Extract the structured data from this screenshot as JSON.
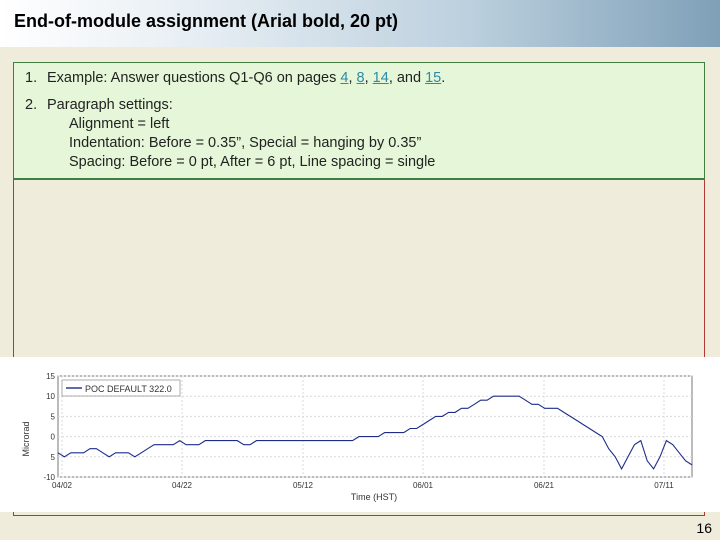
{
  "slide": {
    "title": "End-of-module assignment (Arial bold, 20 pt)",
    "page_number": "16"
  },
  "instructions": {
    "item1": {
      "number": "1.",
      "text_before": "Example: Answer questions Q1-Q6 on pages ",
      "pages": [
        "4",
        "8",
        "14",
        "15"
      ],
      "sep1": ", ",
      "sep2": ", ",
      "sep3": ", and ",
      "end": "."
    },
    "item2": {
      "number": "2.",
      "text": "Paragraph settings:",
      "lines": [
        "Alignment = left",
        "Indentation: Before = 0.35”, Special = hanging by 0.35”",
        "Spacing: Before = 0 pt, After = 6 pt, Line spacing = single"
      ]
    }
  },
  "colors": {
    "link": "#2b8ba8",
    "textbox_bg": "#e5f7d8",
    "frame_border": "#b33a32",
    "series_line": "#1f2d8a"
  },
  "chart_data": {
    "type": "line",
    "ylabel": "Microrad",
    "xlabel": "Time (HST)",
    "xticks": [
      "04/02",
      "04/22",
      "05/12",
      "06/01",
      "06/21",
      "07/11"
    ],
    "yticks": [
      "15",
      "10",
      "5",
      "0",
      "5",
      "-10"
    ],
    "ylim": [
      -10,
      15
    ],
    "grid": true,
    "legend_position": "top-left",
    "series": [
      {
        "name": "POC DEFAULT 322.0",
        "x": [
          0,
          2,
          4,
          6,
          8,
          10,
          12,
          14,
          16,
          18,
          20,
          22,
          24,
          26,
          28,
          30,
          32,
          34,
          36,
          38,
          40,
          42,
          44,
          46,
          48,
          50,
          52,
          54,
          56,
          58,
          60,
          62,
          64,
          66,
          68,
          70,
          72,
          74,
          76,
          78,
          80,
          82,
          84,
          86,
          88,
          90,
          92,
          94,
          96,
          98,
          100,
          102,
          104,
          106,
          108,
          110,
          112,
          114,
          116,
          118,
          120,
          122,
          124,
          126,
          128,
          130,
          132,
          134,
          136,
          138,
          140,
          142,
          144,
          146,
          148,
          150,
          152,
          154,
          156,
          158,
          160,
          162,
          164,
          166,
          168,
          170,
          172,
          174,
          176,
          178,
          180,
          182,
          184,
          186,
          188,
          190,
          192,
          194,
          196,
          198
        ],
        "y": [
          -4,
          -5,
          -4,
          -4,
          -4,
          -3,
          -3,
          -4,
          -5,
          -4,
          -4,
          -4,
          -5,
          -4,
          -3,
          -2,
          -2,
          -2,
          -2,
          -1,
          -2,
          -2,
          -2,
          -1,
          -1,
          -1,
          -1,
          -1,
          -1,
          -2,
          -2,
          -1,
          -1,
          -1,
          -1,
          -1,
          -1,
          -1,
          -1,
          -1,
          -1,
          -1,
          -1,
          -1,
          -1,
          -1,
          -1,
          0,
          0,
          0,
          0,
          1,
          1,
          1,
          1,
          2,
          2,
          3,
          4,
          5,
          5,
          6,
          6,
          7,
          7,
          8,
          9,
          9,
          10,
          10,
          10,
          10,
          10,
          9,
          8,
          8,
          7,
          7,
          7,
          6,
          5,
          4,
          3,
          2,
          1,
          0,
          -3,
          -5,
          -8,
          -5,
          -2,
          -1,
          -6,
          -8,
          -5,
          -1,
          -2,
          -4,
          -6,
          -7
        ]
      }
    ]
  }
}
